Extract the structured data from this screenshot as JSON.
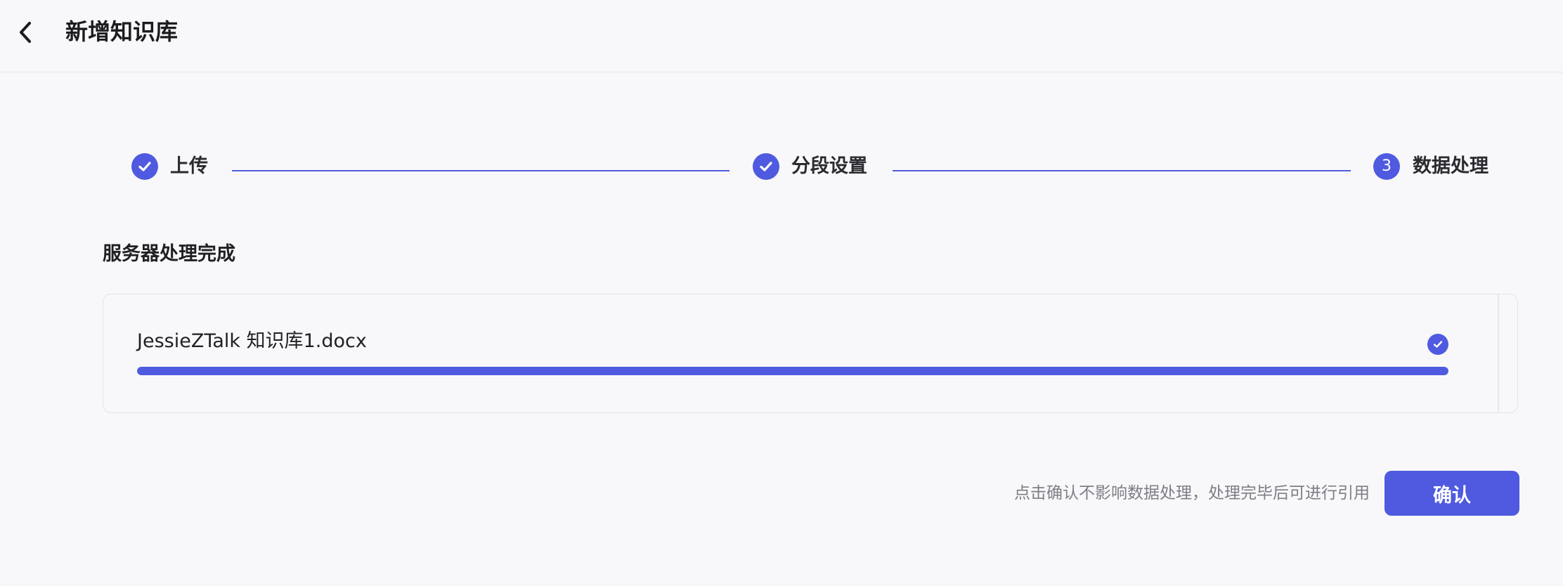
{
  "header": {
    "title": "新增知识库",
    "back_icon": "chevron-left-icon"
  },
  "steps": [
    {
      "label": "上传",
      "status": "done",
      "icon": "check-circle-icon"
    },
    {
      "label": "分段设置",
      "status": "done",
      "icon": "check-circle-icon"
    },
    {
      "label": "数据处理",
      "status": "active",
      "number": "3"
    }
  ],
  "section": {
    "title": "服务器处理完成"
  },
  "file": {
    "name": "JessieZTalk 知识库1.docx",
    "progress_percent": 100,
    "status_icon": "check-circle-icon"
  },
  "footer": {
    "hint": "点击确认不影响数据处理，处理完毕后可进行引用",
    "confirm_label": "确认"
  },
  "colors": {
    "accent": "#4f5ae0",
    "background": "#f8f8fa",
    "hint_text": "#7d7d86"
  }
}
